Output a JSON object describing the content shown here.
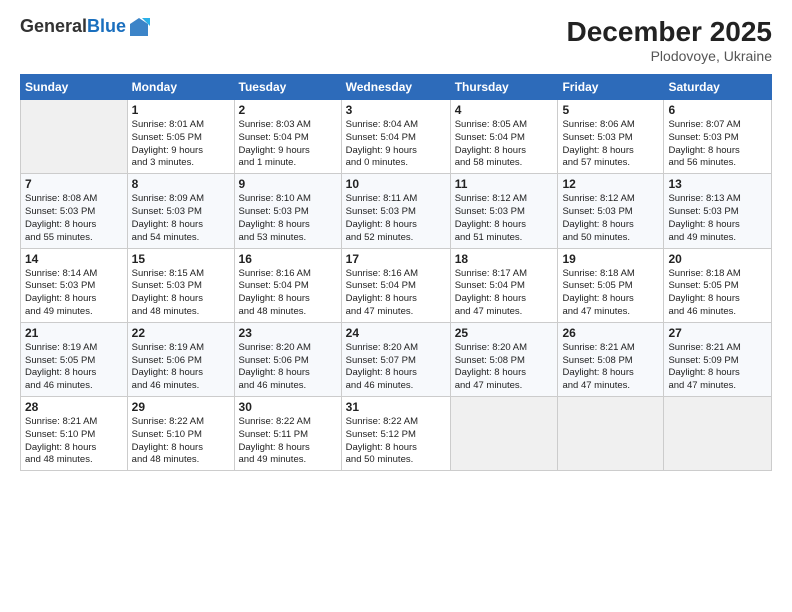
{
  "logo": {
    "general": "General",
    "blue": "Blue"
  },
  "title": "December 2025",
  "subtitle": "Plodovoye, Ukraine",
  "days_header": [
    "Sunday",
    "Monday",
    "Tuesday",
    "Wednesday",
    "Thursday",
    "Friday",
    "Saturday"
  ],
  "weeks": [
    [
      {
        "day": "",
        "info": ""
      },
      {
        "day": "1",
        "info": "Sunrise: 8:01 AM\nSunset: 5:05 PM\nDaylight: 9 hours\nand 3 minutes."
      },
      {
        "day": "2",
        "info": "Sunrise: 8:03 AM\nSunset: 5:04 PM\nDaylight: 9 hours\nand 1 minute."
      },
      {
        "day": "3",
        "info": "Sunrise: 8:04 AM\nSunset: 5:04 PM\nDaylight: 9 hours\nand 0 minutes."
      },
      {
        "day": "4",
        "info": "Sunrise: 8:05 AM\nSunset: 5:04 PM\nDaylight: 8 hours\nand 58 minutes."
      },
      {
        "day": "5",
        "info": "Sunrise: 8:06 AM\nSunset: 5:03 PM\nDaylight: 8 hours\nand 57 minutes."
      },
      {
        "day": "6",
        "info": "Sunrise: 8:07 AM\nSunset: 5:03 PM\nDaylight: 8 hours\nand 56 minutes."
      }
    ],
    [
      {
        "day": "7",
        "info": "Sunrise: 8:08 AM\nSunset: 5:03 PM\nDaylight: 8 hours\nand 55 minutes."
      },
      {
        "day": "8",
        "info": "Sunrise: 8:09 AM\nSunset: 5:03 PM\nDaylight: 8 hours\nand 54 minutes."
      },
      {
        "day": "9",
        "info": "Sunrise: 8:10 AM\nSunset: 5:03 PM\nDaylight: 8 hours\nand 53 minutes."
      },
      {
        "day": "10",
        "info": "Sunrise: 8:11 AM\nSunset: 5:03 PM\nDaylight: 8 hours\nand 52 minutes."
      },
      {
        "day": "11",
        "info": "Sunrise: 8:12 AM\nSunset: 5:03 PM\nDaylight: 8 hours\nand 51 minutes."
      },
      {
        "day": "12",
        "info": "Sunrise: 8:12 AM\nSunset: 5:03 PM\nDaylight: 8 hours\nand 50 minutes."
      },
      {
        "day": "13",
        "info": "Sunrise: 8:13 AM\nSunset: 5:03 PM\nDaylight: 8 hours\nand 49 minutes."
      }
    ],
    [
      {
        "day": "14",
        "info": "Sunrise: 8:14 AM\nSunset: 5:03 PM\nDaylight: 8 hours\nand 49 minutes."
      },
      {
        "day": "15",
        "info": "Sunrise: 8:15 AM\nSunset: 5:03 PM\nDaylight: 8 hours\nand 48 minutes."
      },
      {
        "day": "16",
        "info": "Sunrise: 8:16 AM\nSunset: 5:04 PM\nDaylight: 8 hours\nand 48 minutes."
      },
      {
        "day": "17",
        "info": "Sunrise: 8:16 AM\nSunset: 5:04 PM\nDaylight: 8 hours\nand 47 minutes."
      },
      {
        "day": "18",
        "info": "Sunrise: 8:17 AM\nSunset: 5:04 PM\nDaylight: 8 hours\nand 47 minutes."
      },
      {
        "day": "19",
        "info": "Sunrise: 8:18 AM\nSunset: 5:05 PM\nDaylight: 8 hours\nand 47 minutes."
      },
      {
        "day": "20",
        "info": "Sunrise: 8:18 AM\nSunset: 5:05 PM\nDaylight: 8 hours\nand 46 minutes."
      }
    ],
    [
      {
        "day": "21",
        "info": "Sunrise: 8:19 AM\nSunset: 5:05 PM\nDaylight: 8 hours\nand 46 minutes."
      },
      {
        "day": "22",
        "info": "Sunrise: 8:19 AM\nSunset: 5:06 PM\nDaylight: 8 hours\nand 46 minutes."
      },
      {
        "day": "23",
        "info": "Sunrise: 8:20 AM\nSunset: 5:06 PM\nDaylight: 8 hours\nand 46 minutes."
      },
      {
        "day": "24",
        "info": "Sunrise: 8:20 AM\nSunset: 5:07 PM\nDaylight: 8 hours\nand 46 minutes."
      },
      {
        "day": "25",
        "info": "Sunrise: 8:20 AM\nSunset: 5:08 PM\nDaylight: 8 hours\nand 47 minutes."
      },
      {
        "day": "26",
        "info": "Sunrise: 8:21 AM\nSunset: 5:08 PM\nDaylight: 8 hours\nand 47 minutes."
      },
      {
        "day": "27",
        "info": "Sunrise: 8:21 AM\nSunset: 5:09 PM\nDaylight: 8 hours\nand 47 minutes."
      }
    ],
    [
      {
        "day": "28",
        "info": "Sunrise: 8:21 AM\nSunset: 5:10 PM\nDaylight: 8 hours\nand 48 minutes."
      },
      {
        "day": "29",
        "info": "Sunrise: 8:22 AM\nSunset: 5:10 PM\nDaylight: 8 hours\nand 48 minutes."
      },
      {
        "day": "30",
        "info": "Sunrise: 8:22 AM\nSunset: 5:11 PM\nDaylight: 8 hours\nand 49 minutes."
      },
      {
        "day": "31",
        "info": "Sunrise: 8:22 AM\nSunset: 5:12 PM\nDaylight: 8 hours\nand 50 minutes."
      },
      {
        "day": "",
        "info": ""
      },
      {
        "day": "",
        "info": ""
      },
      {
        "day": "",
        "info": ""
      }
    ]
  ]
}
